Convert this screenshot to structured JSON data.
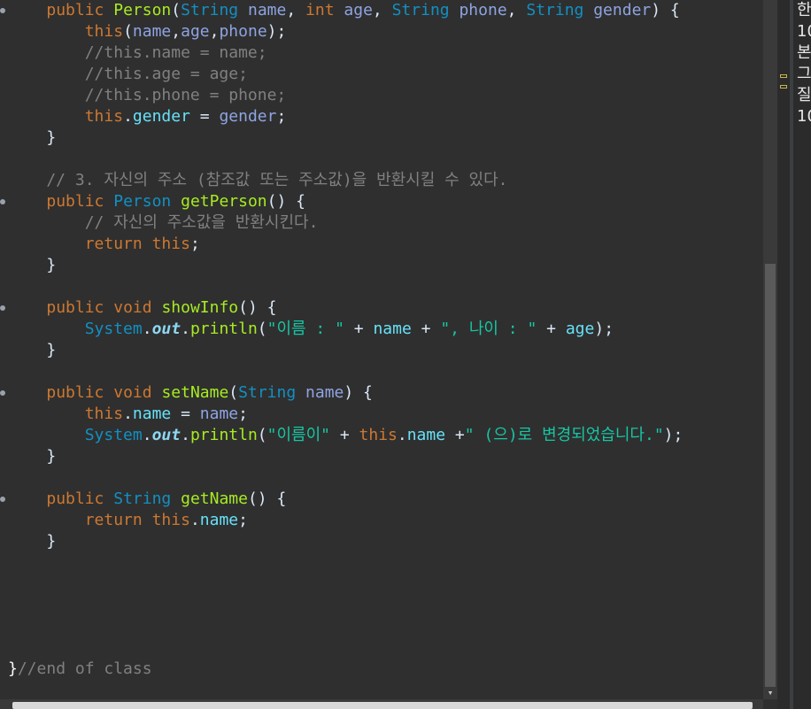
{
  "editor": {
    "language": "java",
    "lines": [
      {
        "mark": true,
        "tokens": [
          [
            "pl",
            "    "
          ],
          [
            "kw",
            "public"
          ],
          [
            "pl",
            " "
          ],
          [
            "fn",
            "Person"
          ],
          [
            "pl",
            "("
          ],
          [
            "ty",
            "String"
          ],
          [
            "pl",
            " "
          ],
          [
            "pr",
            "name"
          ],
          [
            "pl",
            ", "
          ],
          [
            "kw",
            "int"
          ],
          [
            "pl",
            " "
          ],
          [
            "pr",
            "age"
          ],
          [
            "pl",
            ", "
          ],
          [
            "ty",
            "String"
          ],
          [
            "pl",
            " "
          ],
          [
            "pr",
            "phone"
          ],
          [
            "pl",
            ", "
          ],
          [
            "ty",
            "String"
          ],
          [
            "pl",
            " "
          ],
          [
            "pr",
            "gender"
          ],
          [
            "pl",
            ") {"
          ]
        ]
      },
      {
        "mark": false,
        "tokens": [
          [
            "pl",
            "        "
          ],
          [
            "kw",
            "this"
          ],
          [
            "pl",
            "("
          ],
          [
            "pr",
            "name"
          ],
          [
            "pl",
            ","
          ],
          [
            "pr",
            "age"
          ],
          [
            "pl",
            ","
          ],
          [
            "pr",
            "phone"
          ],
          [
            "pl",
            ");"
          ]
        ]
      },
      {
        "mark": false,
        "tokens": [
          [
            "cm",
            "        //this.name = name;"
          ]
        ]
      },
      {
        "mark": false,
        "tokens": [
          [
            "cm",
            "        //this.age = age;"
          ]
        ]
      },
      {
        "mark": false,
        "tokens": [
          [
            "cm",
            "        //this.phone = phone;"
          ]
        ]
      },
      {
        "mark": false,
        "tokens": [
          [
            "pl",
            "        "
          ],
          [
            "kw",
            "this"
          ],
          [
            "pl",
            "."
          ],
          [
            "fd",
            "gender"
          ],
          [
            "pl",
            " = "
          ],
          [
            "pr",
            "gender"
          ],
          [
            "pl",
            ";"
          ]
        ]
      },
      {
        "mark": false,
        "tokens": [
          [
            "pl",
            "    }"
          ]
        ]
      },
      {
        "mark": false,
        "tokens": [
          [
            "pl",
            ""
          ]
        ]
      },
      {
        "mark": false,
        "tokens": [
          [
            "cm",
            "    // 3. 자신의 주소 (참조값 또는 주소값)을 반환시킬 수 있다."
          ]
        ]
      },
      {
        "mark": true,
        "tokens": [
          [
            "pl",
            "    "
          ],
          [
            "kw",
            "public"
          ],
          [
            "pl",
            " "
          ],
          [
            "ty",
            "Person"
          ],
          [
            "pl",
            " "
          ],
          [
            "fn",
            "getPerson"
          ],
          [
            "pl",
            "() {"
          ]
        ]
      },
      {
        "mark": false,
        "tokens": [
          [
            "cm",
            "        // 자신의 주소값을 반환시킨다."
          ]
        ]
      },
      {
        "mark": false,
        "tokens": [
          [
            "pl",
            "        "
          ],
          [
            "kw",
            "return"
          ],
          [
            "pl",
            " "
          ],
          [
            "kw",
            "this"
          ],
          [
            "pl",
            ";"
          ]
        ]
      },
      {
        "mark": false,
        "tokens": [
          [
            "pl",
            "    }"
          ]
        ]
      },
      {
        "mark": false,
        "tokens": [
          [
            "pl",
            ""
          ]
        ]
      },
      {
        "mark": true,
        "tokens": [
          [
            "pl",
            "    "
          ],
          [
            "kw",
            "public"
          ],
          [
            "pl",
            " "
          ],
          [
            "kw",
            "void"
          ],
          [
            "pl",
            " "
          ],
          [
            "fn",
            "showInfo"
          ],
          [
            "pl",
            "() {"
          ]
        ]
      },
      {
        "mark": false,
        "tokens": [
          [
            "pl",
            "        "
          ],
          [
            "ty",
            "System"
          ],
          [
            "pl",
            "."
          ],
          [
            "it",
            "out"
          ],
          [
            "pl",
            "."
          ],
          [
            "fn",
            "println"
          ],
          [
            "pl",
            "("
          ],
          [
            "st",
            "\"이름 : \""
          ],
          [
            "pl",
            " + "
          ],
          [
            "fd",
            "name"
          ],
          [
            "pl",
            " + "
          ],
          [
            "st",
            "\", 나이 : \""
          ],
          [
            "pl",
            " + "
          ],
          [
            "fd",
            "age"
          ],
          [
            "pl",
            ");"
          ]
        ]
      },
      {
        "mark": false,
        "tokens": [
          [
            "pl",
            "    }"
          ]
        ]
      },
      {
        "mark": false,
        "tokens": [
          [
            "pl",
            ""
          ]
        ]
      },
      {
        "mark": true,
        "tokens": [
          [
            "pl",
            "    "
          ],
          [
            "kw",
            "public"
          ],
          [
            "pl",
            " "
          ],
          [
            "kw",
            "void"
          ],
          [
            "pl",
            " "
          ],
          [
            "fn",
            "setName"
          ],
          [
            "pl",
            "("
          ],
          [
            "ty",
            "String"
          ],
          [
            "pl",
            " "
          ],
          [
            "pr",
            "name"
          ],
          [
            "pl",
            ") {"
          ]
        ]
      },
      {
        "mark": false,
        "tokens": [
          [
            "pl",
            "        "
          ],
          [
            "kw",
            "this"
          ],
          [
            "pl",
            "."
          ],
          [
            "fd",
            "name"
          ],
          [
            "pl",
            " = "
          ],
          [
            "pr",
            "name"
          ],
          [
            "pl",
            ";"
          ]
        ]
      },
      {
        "mark": false,
        "tokens": [
          [
            "pl",
            "        "
          ],
          [
            "ty",
            "System"
          ],
          [
            "pl",
            "."
          ],
          [
            "it",
            "out"
          ],
          [
            "pl",
            "."
          ],
          [
            "fn",
            "println"
          ],
          [
            "pl",
            "("
          ],
          [
            "st",
            "\"이름이\""
          ],
          [
            "pl",
            " + "
          ],
          [
            "kw",
            "this"
          ],
          [
            "pl",
            "."
          ],
          [
            "fd",
            "name"
          ],
          [
            "pl",
            " +"
          ],
          [
            "st",
            "\" (으)로 변경되었습니다.\""
          ],
          [
            "pl",
            ");"
          ]
        ]
      },
      {
        "mark": false,
        "tokens": [
          [
            "pl",
            "    }"
          ]
        ]
      },
      {
        "mark": false,
        "tokens": [
          [
            "pl",
            ""
          ]
        ]
      },
      {
        "mark": true,
        "tokens": [
          [
            "pl",
            "    "
          ],
          [
            "kw",
            "public"
          ],
          [
            "pl",
            " "
          ],
          [
            "ty",
            "String"
          ],
          [
            "pl",
            " "
          ],
          [
            "fn",
            "getName"
          ],
          [
            "pl",
            "() {"
          ]
        ]
      },
      {
        "mark": false,
        "tokens": [
          [
            "pl",
            "        "
          ],
          [
            "kw",
            "return"
          ],
          [
            "pl",
            " "
          ],
          [
            "kw",
            "this"
          ],
          [
            "pl",
            "."
          ],
          [
            "fd",
            "name"
          ],
          [
            "pl",
            ";"
          ]
        ]
      },
      {
        "mark": false,
        "tokens": [
          [
            "pl",
            "    }"
          ]
        ]
      },
      {
        "mark": false,
        "tokens": [
          [
            "pl",
            ""
          ]
        ]
      },
      {
        "mark": false,
        "tokens": [
          [
            "pl",
            ""
          ]
        ]
      },
      {
        "mark": false,
        "tokens": [
          [
            "pl",
            ""
          ]
        ]
      },
      {
        "mark": false,
        "tokens": [
          [
            "pl",
            ""
          ]
        ]
      },
      {
        "mark": false,
        "tokens": [
          [
            "pl",
            ""
          ]
        ]
      },
      {
        "mark": false,
        "tokens": [
          [
            "br",
            "}"
          ],
          [
            "cm",
            "//end of class"
          ]
        ]
      }
    ]
  },
  "side_panel": {
    "lines": [
      "한",
      "10",
      "본",
      "그",
      "질",
      "10"
    ]
  },
  "scrollbar": {
    "down_arrow": "▾"
  }
}
